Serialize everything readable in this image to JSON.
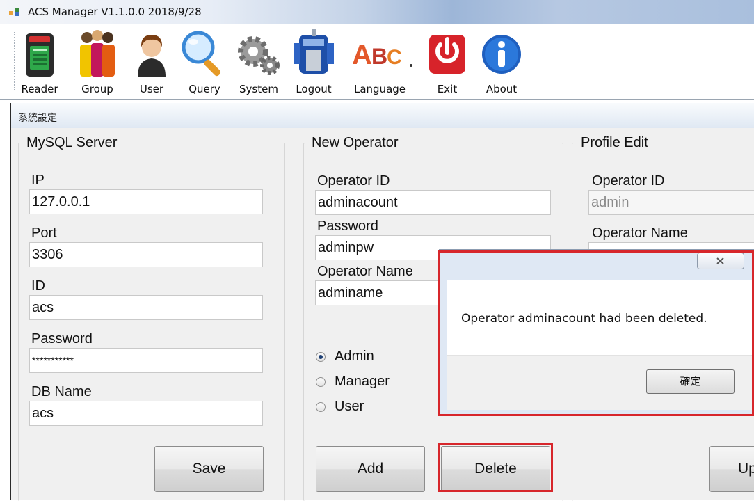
{
  "window": {
    "title": "ACS Manager V1.1.0.0  2018/9/28"
  },
  "toolbar": {
    "items": [
      {
        "label": "Reader",
        "icon": "card-reader-icon"
      },
      {
        "label": "Group",
        "icon": "group-icon"
      },
      {
        "label": "User",
        "icon": "user-icon"
      },
      {
        "label": "Query",
        "icon": "magnifier-icon"
      },
      {
        "label": "System",
        "icon": "gears-icon"
      },
      {
        "label": "Logout",
        "icon": "robot-icon"
      },
      {
        "label": "Language",
        "icon": "language-icon"
      },
      {
        "label": "Exit",
        "icon": "power-icon"
      },
      {
        "label": "About",
        "icon": "info-icon"
      }
    ]
  },
  "tab": {
    "title": "系統設定"
  },
  "mysql": {
    "legend": "MySQL Server",
    "ip_label": "IP",
    "ip_value": "127.0.0.1",
    "port_label": "Port",
    "port_value": "3306",
    "id_label": "ID",
    "id_value": "acs",
    "password_label": "Password",
    "password_value": "***********",
    "dbname_label": "DB Name",
    "dbname_value": "acs",
    "save_label": "Save"
  },
  "new_operator": {
    "legend": "New Operator",
    "operator_id_label": "Operator ID",
    "operator_id_value": "adminacount",
    "password_label": "Password",
    "password_value": "adminpw",
    "operator_name_label": "Operator Name",
    "operator_name_value": "adminame",
    "roles": [
      {
        "label": "Admin",
        "checked": true
      },
      {
        "label": "Manager",
        "checked": false
      },
      {
        "label": "User",
        "checked": false
      }
    ],
    "add_label": "Add",
    "delete_label": "Delete"
  },
  "profile_edit": {
    "legend": "Profile Edit",
    "operator_id_label": "Operator ID",
    "operator_id_value": "admin",
    "operator_name_label": "Operator Name",
    "update_label": "Up"
  },
  "dialog": {
    "message": "Operator adminacount had been deleted.",
    "ok_label": "確定"
  },
  "colors": {
    "highlight": "#d7262b",
    "radio_checked": "#1d3f74"
  }
}
